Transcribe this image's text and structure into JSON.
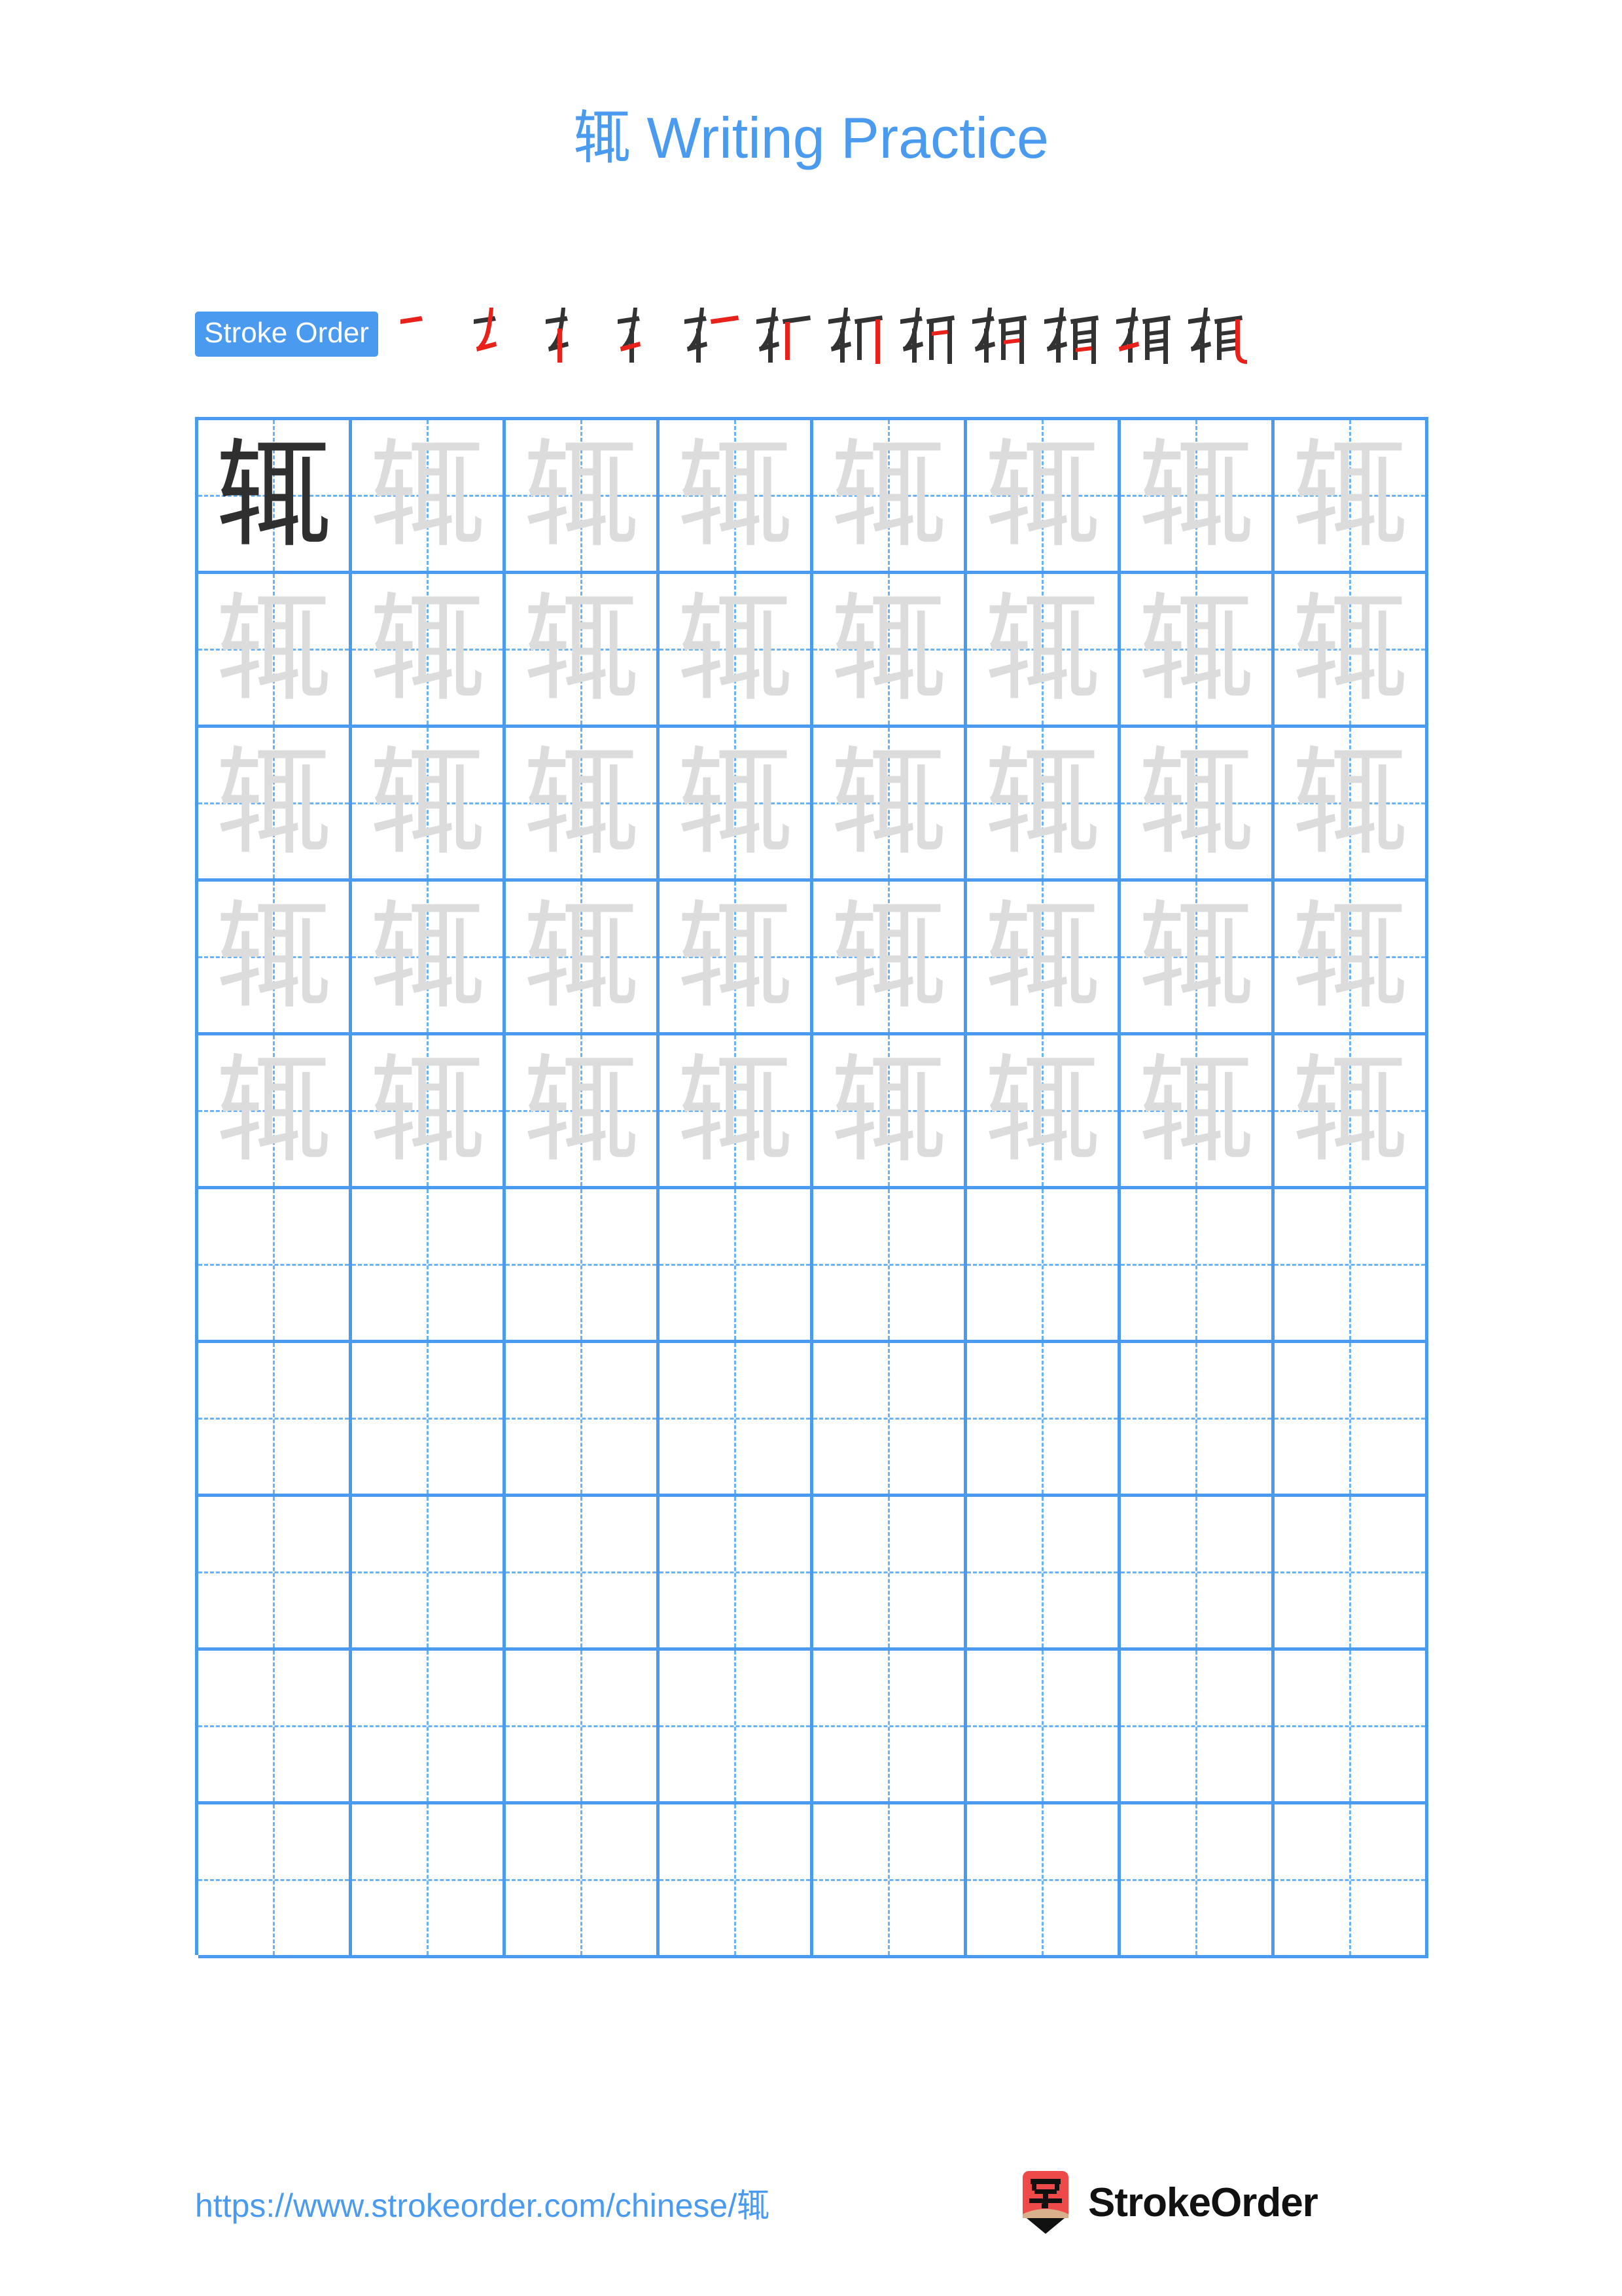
{
  "page": {
    "character": "辄",
    "title": "辄 Writing Practice",
    "title_character": "辄",
    "title_suffix": " Writing Practice",
    "background_color": "#ffffff",
    "accent_color": "#4a9bf0",
    "stroke_highlight_color": "#e8211a",
    "stroke_ink_color": "#333333",
    "trace_color": "#dcdcdc",
    "solid_char_color": "#2f2f2f"
  },
  "stroke_order": {
    "badge_label": "Stroke Order",
    "total_strokes": 12,
    "steps": [
      {
        "index": 1,
        "glyph": "辄",
        "new_stroke": "横 (heng)"
      },
      {
        "index": 2,
        "glyph": "辄",
        "new_stroke": "竖折 (shuzhe)"
      },
      {
        "index": 3,
        "glyph": "辄",
        "new_stroke": "竖 (shu)"
      },
      {
        "index": 4,
        "glyph": "辄",
        "new_stroke": "提 (ti)"
      },
      {
        "index": 5,
        "glyph": "辄",
        "new_stroke": "横 (heng)"
      },
      {
        "index": 6,
        "glyph": "辄",
        "new_stroke": "竖 (shu)"
      },
      {
        "index": 7,
        "glyph": "辄",
        "new_stroke": "竖 (shu)"
      },
      {
        "index": 8,
        "glyph": "辄",
        "new_stroke": "横 (heng)"
      },
      {
        "index": 9,
        "glyph": "辄",
        "new_stroke": "横 (heng)"
      },
      {
        "index": 10,
        "glyph": "辄",
        "new_stroke": "横 (heng)"
      },
      {
        "index": 11,
        "glyph": "辄",
        "new_stroke": "提 (ti)"
      },
      {
        "index": 12,
        "glyph": "辄",
        "new_stroke": "竖弯钩 (shuwangou)"
      }
    ]
  },
  "practice_grid": {
    "columns": 8,
    "rows": 10,
    "traced_rows": 5,
    "blank_rows": 5,
    "first_cell_style": "solid",
    "grid_line_color": "#4a9bf0",
    "guide_line_color": "#6cb2f5",
    "rows_data": [
      {
        "row": 1,
        "cells": [
          "辄",
          "辄",
          "辄",
          "辄",
          "辄",
          "辄",
          "辄",
          "辄"
        ],
        "styles": [
          "solid",
          "trace",
          "trace",
          "trace",
          "trace",
          "trace",
          "trace",
          "trace"
        ]
      },
      {
        "row": 2,
        "cells": [
          "辄",
          "辄",
          "辄",
          "辄",
          "辄",
          "辄",
          "辄",
          "辄"
        ],
        "styles": [
          "trace",
          "trace",
          "trace",
          "trace",
          "trace",
          "trace",
          "trace",
          "trace"
        ]
      },
      {
        "row": 3,
        "cells": [
          "辄",
          "辄",
          "辄",
          "辄",
          "辄",
          "辄",
          "辄",
          "辄"
        ],
        "styles": [
          "trace",
          "trace",
          "trace",
          "trace",
          "trace",
          "trace",
          "trace",
          "trace"
        ]
      },
      {
        "row": 4,
        "cells": [
          "辄",
          "辄",
          "辄",
          "辄",
          "辄",
          "辄",
          "辄",
          "辄"
        ],
        "styles": [
          "trace",
          "trace",
          "trace",
          "trace",
          "trace",
          "trace",
          "trace",
          "trace"
        ]
      },
      {
        "row": 5,
        "cells": [
          "辄",
          "辄",
          "辄",
          "辄",
          "辄",
          "辄",
          "辄",
          "辄"
        ],
        "styles": [
          "trace",
          "trace",
          "trace",
          "trace",
          "trace",
          "trace",
          "trace",
          "trace"
        ]
      },
      {
        "row": 6,
        "cells": [
          "",
          "",
          "",
          "",
          "",
          "",
          "",
          ""
        ],
        "styles": [
          "blank",
          "blank",
          "blank",
          "blank",
          "blank",
          "blank",
          "blank",
          "blank"
        ]
      },
      {
        "row": 7,
        "cells": [
          "",
          "",
          "",
          "",
          "",
          "",
          "",
          ""
        ],
        "styles": [
          "blank",
          "blank",
          "blank",
          "blank",
          "blank",
          "blank",
          "blank",
          "blank"
        ]
      },
      {
        "row": 8,
        "cells": [
          "",
          "",
          "",
          "",
          "",
          "",
          "",
          ""
        ],
        "styles": [
          "blank",
          "blank",
          "blank",
          "blank",
          "blank",
          "blank",
          "blank",
          "blank"
        ]
      },
      {
        "row": 9,
        "cells": [
          "",
          "",
          "",
          "",
          "",
          "",
          "",
          ""
        ],
        "styles": [
          "blank",
          "blank",
          "blank",
          "blank",
          "blank",
          "blank",
          "blank",
          "blank"
        ]
      },
      {
        "row": 10,
        "cells": [
          "",
          "",
          "",
          "",
          "",
          "",
          "",
          ""
        ],
        "styles": [
          "blank",
          "blank",
          "blank",
          "blank",
          "blank",
          "blank",
          "blank",
          "blank"
        ]
      }
    ]
  },
  "footer": {
    "url": "https://www.strokeorder.com/chinese/辄",
    "brand_name": "StrokeOrder",
    "logo_icon": "pencil-zi-logo",
    "logo_character": "字",
    "logo_body_color": "#ef4a4a",
    "logo_wood_color": "#d8b08c",
    "logo_tip_color": "#111111"
  }
}
